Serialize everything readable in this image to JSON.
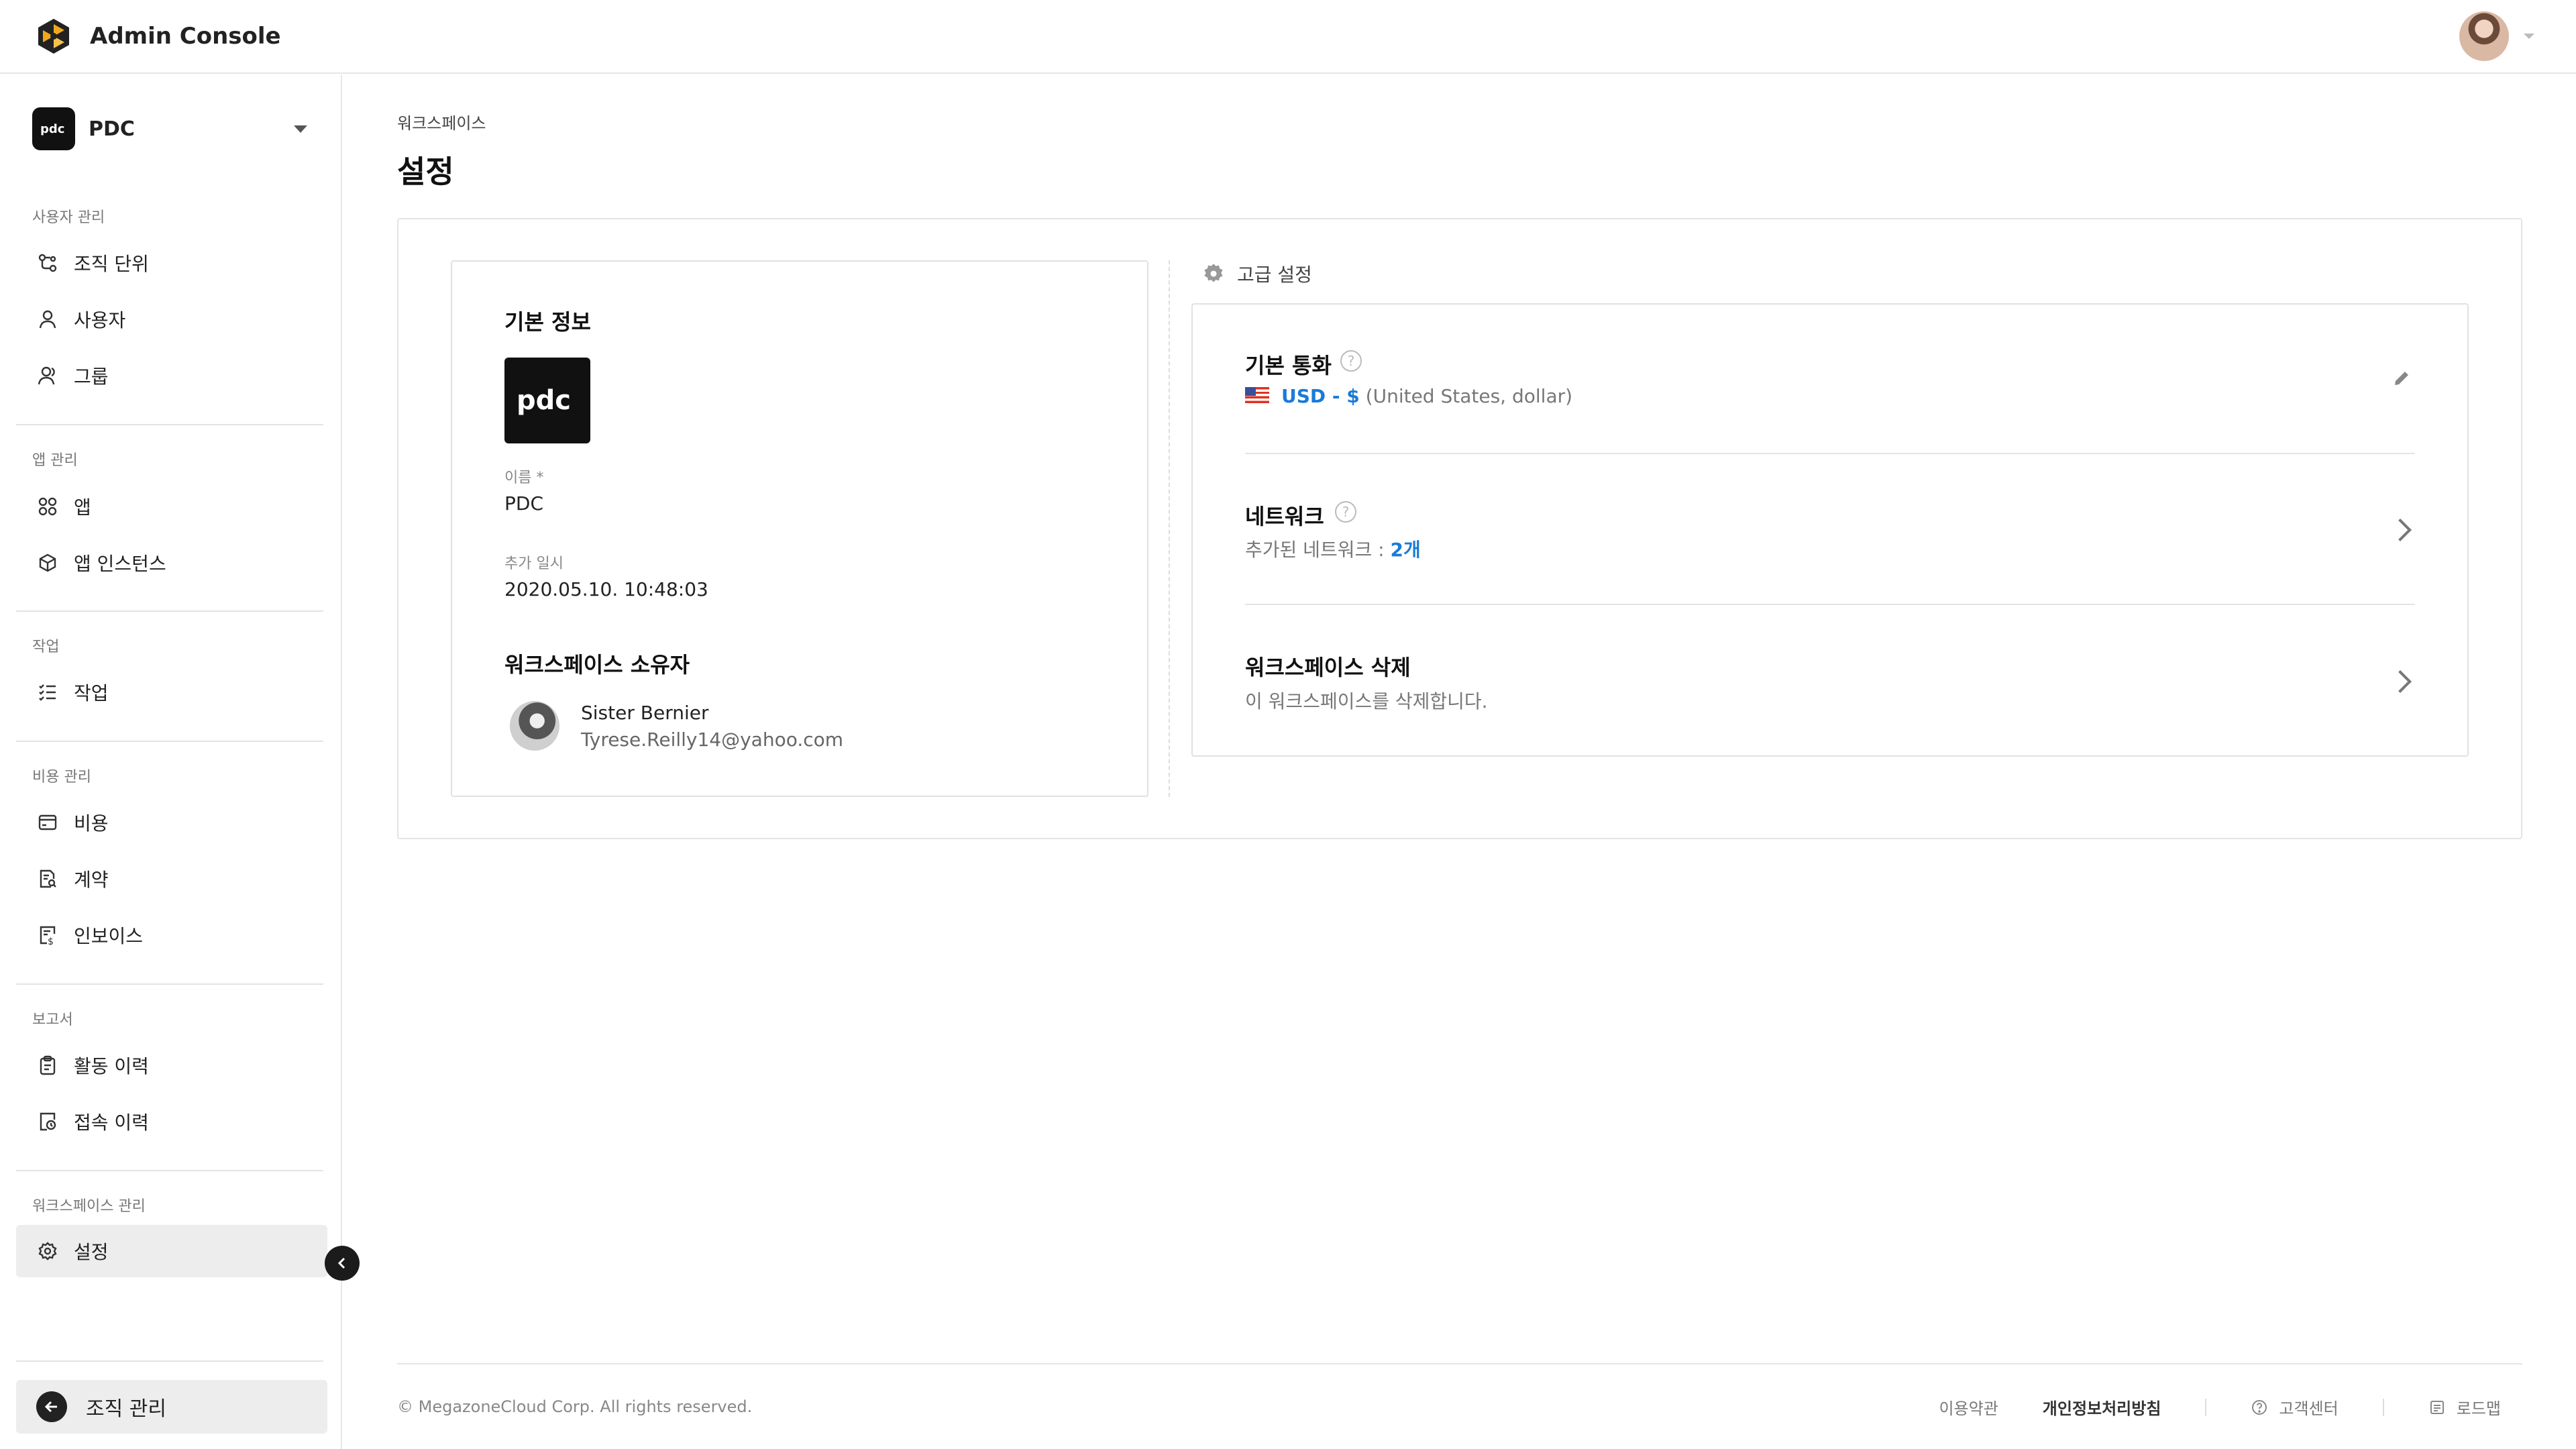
{
  "app": {
    "title": "Admin Console"
  },
  "workspace": {
    "name": "PDC"
  },
  "sidebar": {
    "sections": [
      {
        "title": "사용자 관리",
        "items": [
          {
            "label": "조직 단위",
            "icon": "org-unit-icon"
          },
          {
            "label": "사용자",
            "icon": "user-icon"
          },
          {
            "label": "그룹",
            "icon": "group-icon"
          }
        ]
      },
      {
        "title": "앱 관리",
        "items": [
          {
            "label": "앱",
            "icon": "apps-icon"
          },
          {
            "label": "앱 인스턴스",
            "icon": "cube-icon"
          }
        ]
      },
      {
        "title": "작업",
        "items": [
          {
            "label": "작업",
            "icon": "task-list-icon"
          }
        ]
      },
      {
        "title": "비용 관리",
        "items": [
          {
            "label": "비용",
            "icon": "wallet-icon"
          },
          {
            "label": "계약",
            "icon": "contract-icon"
          },
          {
            "label": "인보이스",
            "icon": "invoice-icon"
          }
        ]
      },
      {
        "title": "보고서",
        "items": [
          {
            "label": "활동 이력",
            "icon": "clipboard-icon"
          },
          {
            "label": "접속 이력",
            "icon": "access-history-icon"
          }
        ]
      },
      {
        "title": "워크스페이스 관리",
        "items": [
          {
            "label": "설정",
            "icon": "gear-icon",
            "active": true
          }
        ]
      }
    ],
    "org_button": "조직 관리"
  },
  "main": {
    "breadcrumb": "워크스페이스",
    "title": "설정",
    "basic_info": {
      "title": "기본 정보",
      "name_label": "이름 *",
      "name_value": "PDC",
      "added_label": "추가 일시",
      "added_value": "2020.05.10. 10:48:03",
      "owner_title": "워크스페이스 소유자",
      "owner_name": "Sister Bernier",
      "owner_email": "Tyrese.Reilly14@yahoo.com"
    },
    "advanced": {
      "title": "고급 설정",
      "currency": {
        "title": "기본 통화",
        "code": "USD - $",
        "desc": "(United States, dollar)"
      },
      "network": {
        "title": "네트워크",
        "prefix": "추가된 네트워크 : ",
        "count": "2개"
      },
      "delete": {
        "title": "워크스페이스 삭제",
        "desc": "이 워크스페이스를 삭제합니다."
      }
    }
  },
  "footer": {
    "copyright": "© MegazoneCloud Corp. All rights reserved.",
    "terms": "이용약관",
    "privacy": "개인정보처리방침",
    "support": "고객센터",
    "roadmap": "로드맵"
  },
  "colors": {
    "accent": "#1a7bd8",
    "brand": "#f0a81c",
    "active_bg": "#ededed"
  }
}
